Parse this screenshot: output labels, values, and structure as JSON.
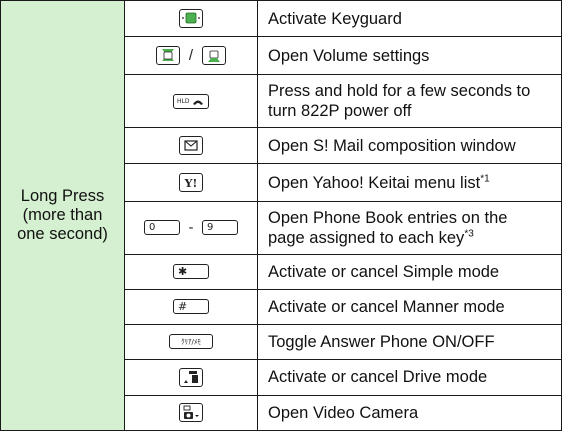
{
  "category": {
    "line1": "Long Press",
    "line2": "(more than",
    "line3": "one second)"
  },
  "key_separators": {
    "volume": "/",
    "phonebook": "-"
  },
  "rows": [
    {
      "key_icon": "multi-select-center-key-icon",
      "description": "Activate Keyguard"
    },
    {
      "key_icon": "multi-select-up-down-keys-icon",
      "description": "Open Volume settings"
    },
    {
      "key_icon": "power-end-key-icon",
      "description_line1": "Press and hold for a few seconds to",
      "description_line2": "turn 822P power off"
    },
    {
      "key_icon": "mail-key-icon",
      "description": "Open S! Mail composition window"
    },
    {
      "key_icon": "yahoo-key-icon",
      "description": "Open Yahoo! Keitai menu list",
      "note": "*1"
    },
    {
      "key_icon": "digit-0-to-9-keys-icon",
      "description_line1": "Open Phone Book entries on the",
      "description_line2": "page assigned to each key",
      "note": "*3"
    },
    {
      "key_icon": "star-key-icon",
      "description": "Activate or cancel Simple mode"
    },
    {
      "key_icon": "pound-key-icon",
      "description": "Activate or cancel Manner mode"
    },
    {
      "key_icon": "clear-memo-key-icon",
      "description": "Toggle Answer Phone ON/OFF"
    },
    {
      "key_icon": "character-key-icon",
      "description": "Activate or cancel Drive mode"
    },
    {
      "key_icon": "camera-key-icon",
      "description": "Open Video Camera"
    }
  ],
  "key_text": {
    "power": "HLD",
    "clear": "ｸﾘｱ/ﾒﾓ",
    "star": "✱",
    "pound": "#",
    "zero": "0",
    "nine": "9"
  },
  "colors": {
    "category_bg": "#d5f0d0",
    "key_green": "#4caf50",
    "border": "#1a1a1a"
  }
}
